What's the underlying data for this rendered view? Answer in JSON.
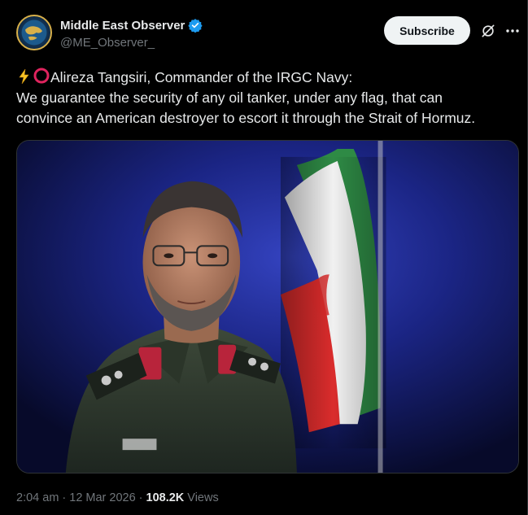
{
  "author": {
    "display_name": "Middle East Observer",
    "handle": "@ME_Observer_",
    "verified": true,
    "avatar_icon": "globe-logo-icon"
  },
  "actions": {
    "subscribe_label": "Subscribe",
    "grok_icon": "grok-icon",
    "more_icon": "more-icon"
  },
  "post": {
    "lines": [
      "Alireza Tangsiri, Commander of the IRGC Navy:",
      "We guarantee the security of any oil tanker, under any flag, that can",
      "convince an American destroyer to escort it through the Strait of Hormuz."
    ],
    "prefix_icons": [
      "lightning-emoji",
      "red-circle-emoji"
    ]
  },
  "media": {
    "image_icon": "photo-commander-with-flag"
  },
  "meta": {
    "time": "2:04 am",
    "separator": "·",
    "date": "12 Mar 2026",
    "views_count": "108.2K",
    "views_label": "Views"
  },
  "colors": {
    "background": "#000000",
    "text": "#e7e9ea",
    "muted": "#71767b",
    "verified_blue": "#1d9bf0",
    "subscribe_bg": "#eff3f4"
  }
}
